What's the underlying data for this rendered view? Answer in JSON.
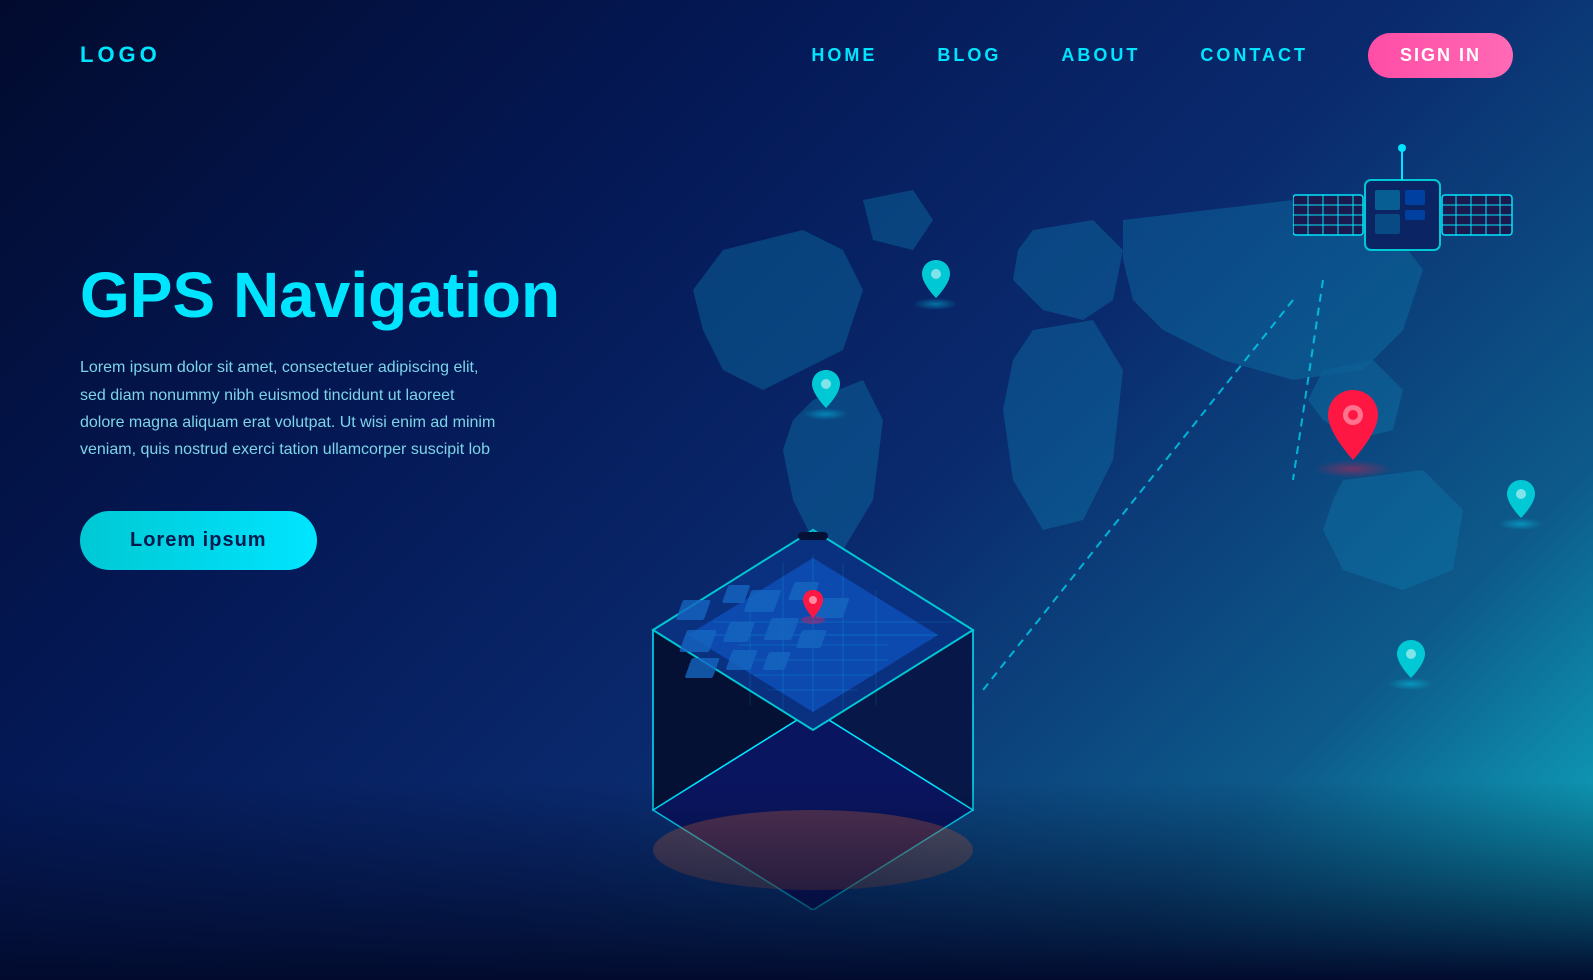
{
  "nav": {
    "logo": "LOGO",
    "links": [
      "HOME",
      "BLOG",
      "ABOUT",
      "CONTACT"
    ],
    "signin": "SIGN IN"
  },
  "hero": {
    "title": "GPS Navigation",
    "description": "Lorem ipsum dolor sit amet, consectetuer adipiscing elit, sed diam nonummy nibh euismod tincidunt ut laoreet dolore magna aliquam erat volutpat. Ut wisi enim ad minim veniam, quis nostrud exerci tation ullamcorper suscipit lob",
    "button": "Lorem ipsum"
  },
  "colors": {
    "accent_cyan": "#00e5ff",
    "accent_pink": "#ff4da6",
    "accent_red": "#ff1744",
    "bg_dark": "#020b2e",
    "nav_text": "#00e5ff"
  }
}
